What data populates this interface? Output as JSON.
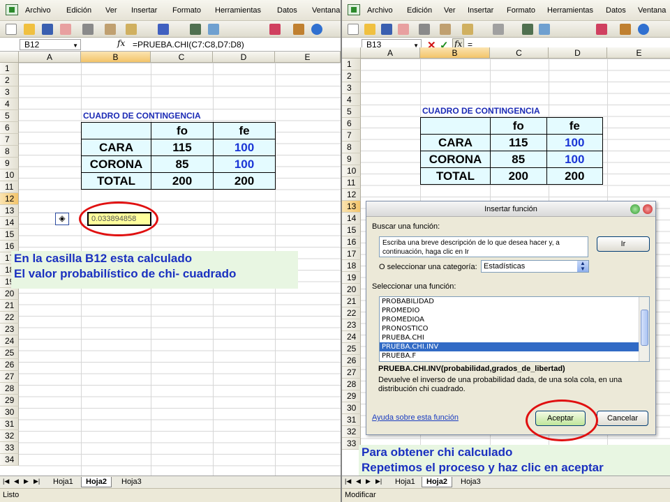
{
  "menu": [
    "Archivo",
    "Edición",
    "Ver",
    "Insertar",
    "Formato",
    "Herramientas",
    "Datos",
    "Ventana"
  ],
  "left": {
    "name_box": "B12",
    "formula": "=PRUEBA.CHI(C7:C8,D7:D8)",
    "fx": "fx",
    "columns": [
      "A",
      "B",
      "C",
      "D",
      "E"
    ],
    "rows": [
      "1",
      "2",
      "3",
      "4",
      "5",
      "6",
      "7",
      "8",
      "9",
      "10",
      "11",
      "12",
      "13",
      "14",
      "15",
      "16",
      "17",
      "18",
      "19",
      "20",
      "21",
      "22",
      "23",
      "24",
      "25",
      "26",
      "27",
      "28",
      "29",
      "30",
      "31",
      "32",
      "33",
      "34"
    ],
    "result_value": "0.033894858",
    "note_line1": "En la casilla B12 esta calculado",
    "note_line2": "El valor probabilístico de chi- cuadrado",
    "status": "Listo"
  },
  "right": {
    "name_box": "B13",
    "formula": "=",
    "columns": [
      "A",
      "B",
      "C",
      "D",
      "E"
    ],
    "rows": [
      "1",
      "2",
      "3",
      "4",
      "5",
      "6",
      "7",
      "8",
      "9",
      "10",
      "11",
      "12",
      "13",
      "14",
      "15",
      "16",
      "17",
      "18",
      "19",
      "20",
      "21",
      "22",
      "23",
      "24",
      "25",
      "26",
      "27",
      "28",
      "29",
      "30",
      "31",
      "32",
      "33"
    ],
    "note_line1": "Para obtener chi calculado",
    "note_line2": "Repetimos el proceso y haz clic en aceptar",
    "status": "Modificar"
  },
  "table": {
    "title": "CUADRO DE CONTINGENCIA",
    "header": [
      "",
      "fo",
      "fe"
    ],
    "rows": [
      [
        "CARA",
        "115",
        "100"
      ],
      [
        "CORONA",
        "85",
        "100"
      ],
      [
        "TOTAL",
        "200",
        "200"
      ]
    ]
  },
  "sheet_tabs": [
    "Hoja1",
    "Hoja2",
    "Hoja3"
  ],
  "active_sheet": "Hoja2",
  "dialog": {
    "title": "Insertar función",
    "search_label": "Buscar una función:",
    "search_text": "Escriba una breve descripción de lo que desea hacer y, a continuación, haga clic en Ir",
    "go_button": "Ir",
    "category_label": "O seleccionar una categoría:",
    "category_value": "Estadísticas",
    "function_label": "Seleccionar una función:",
    "functions": [
      "PROBABILIDAD",
      "PROMEDIO",
      "PROMEDIOA",
      "PRONOSTICO",
      "PRUEBA.CHI",
      "PRUEBA.CHI.INV",
      "PRUEBA.F"
    ],
    "selected_function": "PRUEBA.CHI.INV",
    "syntax": "PRUEBA.CHI.INV(probabilidad,grados_de_libertad)",
    "description": "Devuelve el inverso de una probabilidad dada, de una sola cola, en una distribución chi cuadrado.",
    "help_link": "Ayuda sobre esta función",
    "ok_button": "Aceptar",
    "cancel_button": "Cancelar"
  }
}
